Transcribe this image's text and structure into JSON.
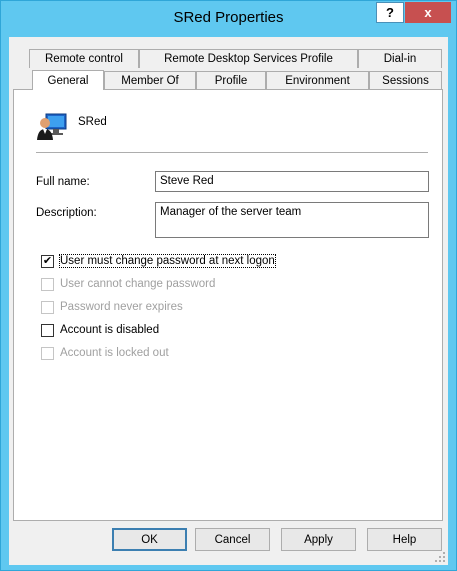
{
  "window": {
    "title": "SRed Properties",
    "help_glyph": "?",
    "close_glyph": "x"
  },
  "tabs_back": [
    {
      "label": "Remote control"
    },
    {
      "label": "Remote Desktop Services Profile"
    },
    {
      "label": "Dial-in"
    }
  ],
  "tabs_front": [
    {
      "label": "General",
      "active": true
    },
    {
      "label": "Member Of"
    },
    {
      "label": "Profile"
    },
    {
      "label": "Environment"
    },
    {
      "label": "Sessions"
    }
  ],
  "general": {
    "user_name": "SRed",
    "full_name_label": "Full name:",
    "full_name_value": "Steve Red",
    "description_label": "Description:",
    "description_value": "Manager of the server team"
  },
  "options": [
    {
      "label": "User must change password at next logon",
      "checked": true,
      "enabled": true
    },
    {
      "label": "User cannot change password",
      "checked": false,
      "enabled": false
    },
    {
      "label": "Password never expires",
      "checked": false,
      "enabled": false
    },
    {
      "label": "Account is disabled",
      "checked": false,
      "enabled": true
    },
    {
      "label": "Account is locked out",
      "checked": false,
      "enabled": false
    }
  ],
  "buttons": {
    "ok": "OK",
    "cancel": "Cancel",
    "apply": "Apply",
    "help": "Help"
  },
  "icons": {
    "user": "user-monitor-icon",
    "check": "checkmark-icon",
    "grip": "resize-grip-icon"
  },
  "colors": {
    "titlebar": "#5fc8f0",
    "close": "#c75050"
  }
}
